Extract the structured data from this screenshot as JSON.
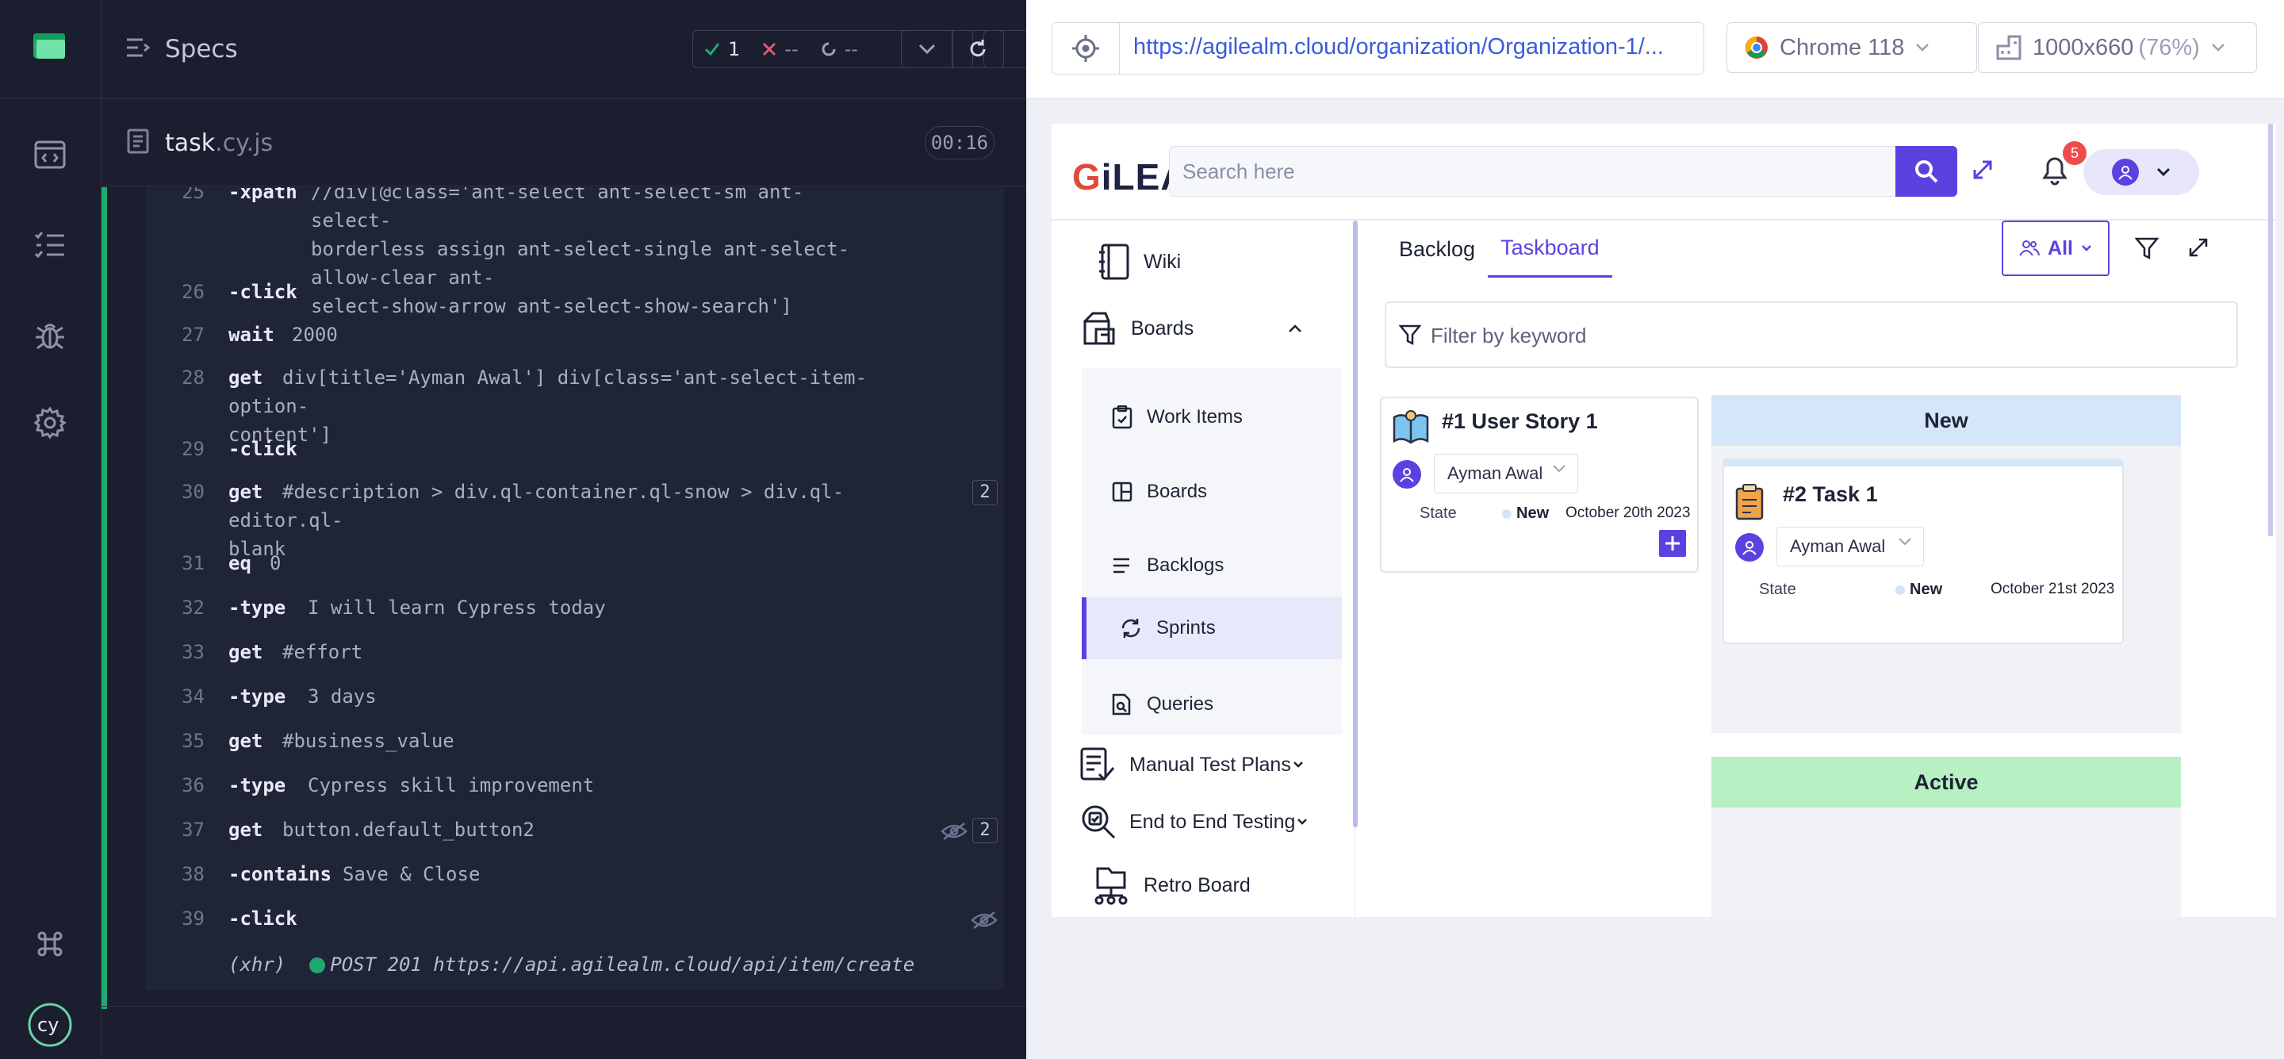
{
  "runner": {
    "specs_label": "Specs",
    "stats": {
      "passed": "1",
      "failed": "--",
      "pending": "--"
    },
    "file": {
      "name": "task",
      "ext": ".cy.js"
    },
    "timer": "00:16"
  },
  "log": {
    "rows": [
      {
        "num": "25",
        "name": "-xpath",
        "msg": "//div[@class='ant-select ant-select-sm ant-select-\nborderless assign ant-select-single ant-select-allow-clear ant-\nselect-show-arrow ant-select-show-search']"
      },
      {
        "num": "26",
        "name": "-click",
        "msg": ""
      },
      {
        "num": "27",
        "name": "wait",
        "msg": "2000"
      },
      {
        "num": "28",
        "name": "get",
        "msg": "div[title='Ayman Awal'] div[class='ant-select-item-option-\ncontent']"
      },
      {
        "num": "29",
        "name": "-click",
        "msg": ""
      },
      {
        "num": "30",
        "name": "get",
        "msg": "#description > div.ql-container.ql-snow > div.ql-editor.ql-\nblank",
        "badge": "2"
      },
      {
        "num": "31",
        "name": "eq",
        "msg": "0"
      },
      {
        "num": "32",
        "name": "-type",
        "msg": "I will learn Cypress today"
      },
      {
        "num": "33",
        "name": "get",
        "msg": "#effort"
      },
      {
        "num": "34",
        "name": "-type",
        "msg": "3 days"
      },
      {
        "num": "35",
        "name": "get",
        "msg": "#business_value"
      },
      {
        "num": "36",
        "name": "-type",
        "msg": "Cypress skill improvement"
      },
      {
        "num": "37",
        "name": "get",
        "msg": "button.default_button2",
        "badge": "2"
      },
      {
        "num": "38",
        "name": "-contains",
        "msg": "Save & Close"
      },
      {
        "num": "39",
        "name": "-click",
        "msg": ""
      }
    ],
    "xhr": {
      "prefix": "(xhr)",
      "text": "POST 201 https://api.agilealm.cloud/api/item/create"
    }
  },
  "browser": {
    "url": "https://agilealm.cloud/organization/Organization-1/...",
    "browser_name": "Chrome 118",
    "viewport": "1000x660",
    "zoom": "(76%)"
  },
  "app": {
    "brand_g": "G",
    "brand_rest": "iLEA",
    "search_placeholder": "Search here",
    "notifications": "5",
    "sidebar": {
      "wiki": "Wiki",
      "boards": "Boards",
      "sub": [
        "Work Items",
        "Boards",
        "Backlogs",
        "Sprints",
        "Queries"
      ],
      "manual_test_plans": "Manual Test Plans",
      "e2e_testing": "End to End Testing",
      "retro_board": "Retro Board"
    },
    "tabs": [
      "Backlog",
      "Taskboard"
    ],
    "all_label": "All",
    "filter_placeholder": "Filter by keyword",
    "story_card": {
      "title": "#1 User Story 1",
      "assignee": "Ayman Awal",
      "state_label": "State",
      "state": "New",
      "date": "October 20th 2023"
    },
    "columns": [
      {
        "name": "New",
        "color": "#d6e6f9"
      },
      {
        "name": "Active",
        "color": "#b7f0c2"
      }
    ],
    "task_card": {
      "title": "#2 Task 1",
      "assignee": "Ayman Awal",
      "state_label": "State",
      "state": "New",
      "date": "October 21st 2023"
    }
  }
}
